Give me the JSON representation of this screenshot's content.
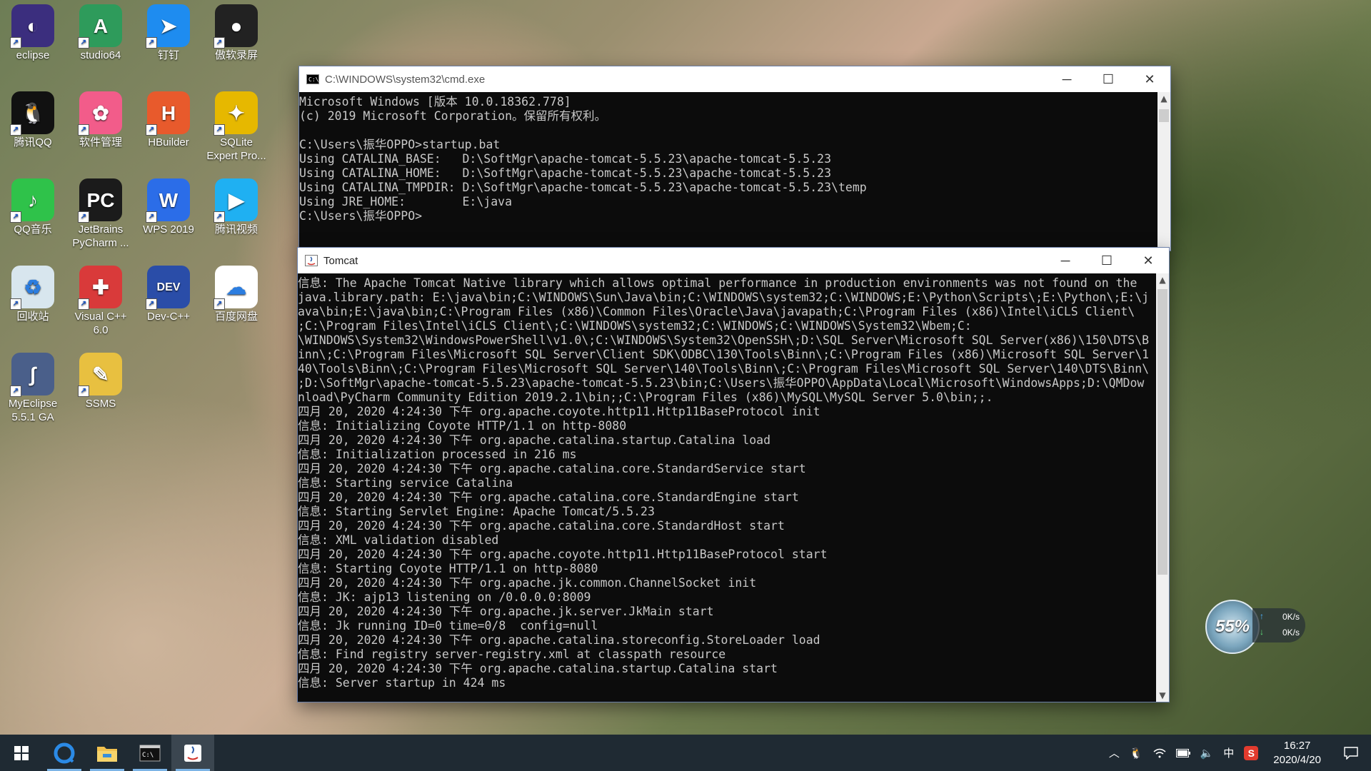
{
  "desktop": {
    "icons": [
      {
        "label": "eclipse",
        "color": "#3b2e7e",
        "symbol": "◐"
      },
      {
        "label": "studio64",
        "color": "#2e9b5b",
        "symbol": "A"
      },
      {
        "label": "钉钉",
        "color": "#1e8cf0",
        "symbol": "➤"
      },
      {
        "label": "傲软录屏",
        "color": "#222222",
        "symbol": "●"
      },
      {
        "label": "腾讯QQ",
        "color": "#111111",
        "symbol": "🐧"
      },
      {
        "label": "软件管理",
        "color": "#f25c8a",
        "symbol": "✿"
      },
      {
        "label": "HBuilder",
        "color": "#e85a2c",
        "symbol": "H"
      },
      {
        "label": "SQLite Expert Pro...",
        "color": "#e6b800",
        "symbol": "✦"
      },
      {
        "label": "QQ音乐",
        "color": "#2fc24a",
        "symbol": "♪"
      },
      {
        "label": "JetBrains PyCharm ...",
        "color": "#1b1b1b",
        "symbol": "PC"
      },
      {
        "label": "WPS 2019",
        "color": "#2b6de8",
        "symbol": "W"
      },
      {
        "label": "腾讯视频",
        "color": "#1fb0f2",
        "symbol": "▶"
      },
      {
        "label": "回收站",
        "color": "#d8e6ee",
        "symbol": "♻"
      },
      {
        "label": "Visual C++ 6.0",
        "color": "#d93a3a",
        "symbol": "✚"
      },
      {
        "label": "Dev-C++",
        "color": "#2a4da8",
        "symbol": "DEV"
      },
      {
        "label": "百度网盘",
        "color": "#ffffff",
        "symbol": "☁"
      },
      {
        "label": "MyEclipse 5.5.1 GA",
        "color": "#4a5f8a",
        "symbol": "∫"
      },
      {
        "label": "SSMS",
        "color": "#e8c040",
        "symbol": "✎"
      }
    ]
  },
  "cmd_window": {
    "title": "C:\\WINDOWS\\system32\\cmd.exe",
    "lines": [
      "Microsoft Windows [版本 10.0.18362.778]",
      "(c) 2019 Microsoft Corporation。保留所有权利。",
      "",
      "C:\\Users\\振华OPPO>startup.bat",
      "Using CATALINA_BASE:   D:\\SoftMgr\\apache-tomcat-5.5.23\\apache-tomcat-5.5.23",
      "Using CATALINA_HOME:   D:\\SoftMgr\\apache-tomcat-5.5.23\\apache-tomcat-5.5.23",
      "Using CATALINA_TMPDIR: D:\\SoftMgr\\apache-tomcat-5.5.23\\apache-tomcat-5.5.23\\temp",
      "Using JRE_HOME:        E:\\java",
      "C:\\Users\\振华OPPO>"
    ]
  },
  "tomcat_window": {
    "title": "Tomcat",
    "lines": [
      "信息: The Apache Tomcat Native library which allows optimal performance in production environments was not found on the",
      "java.library.path: E:\\java\\bin;C:\\WINDOWS\\Sun\\Java\\bin;C:\\WINDOWS\\system32;C:\\WINDOWS;E:\\Python\\Scripts\\;E:\\Python\\;E:\\j",
      "ava\\bin;E:\\java\\bin;C:\\Program Files (x86)\\Common Files\\Oracle\\Java\\javapath;C:\\Program Files (x86)\\Intel\\iCLS Client\\",
      ";C:\\Program Files\\Intel\\iCLS Client\\;C:\\WINDOWS\\system32;C:\\WINDOWS;C:\\WINDOWS\\System32\\Wbem;C:",
      "\\WINDOWS\\System32\\WindowsPowerShell\\v1.0\\;C:\\WINDOWS\\System32\\OpenSSH\\;D:\\SQL Server\\Microsoft SQL Server(x86)\\150\\DTS\\B",
      "inn\\;C:\\Program Files\\Microsoft SQL Server\\Client SDK\\ODBC\\130\\Tools\\Binn\\;C:\\Program Files (x86)\\Microsoft SQL Server\\1",
      "40\\Tools\\Binn\\;C:\\Program Files\\Microsoft SQL Server\\140\\Tools\\Binn\\;C:\\Program Files\\Microsoft SQL Server\\140\\DTS\\Binn\\",
      ";D:\\SoftMgr\\apache-tomcat-5.5.23\\apache-tomcat-5.5.23\\bin;C:\\Users\\振华OPPO\\AppData\\Local\\Microsoft\\WindowsApps;D:\\QMDow",
      "nload\\PyCharm Community Edition 2019.2.1\\bin;;C:\\Program Files (x86)\\MySQL\\MySQL Server 5.0\\bin;;.",
      "四月 20, 2020 4:24:30 下午 org.apache.coyote.http11.Http11BaseProtocol init",
      "信息: Initializing Coyote HTTP/1.1 on http-8080",
      "四月 20, 2020 4:24:30 下午 org.apache.catalina.startup.Catalina load",
      "信息: Initialization processed in 216 ms",
      "四月 20, 2020 4:24:30 下午 org.apache.catalina.core.StandardService start",
      "信息: Starting service Catalina",
      "四月 20, 2020 4:24:30 下午 org.apache.catalina.core.StandardEngine start",
      "信息: Starting Servlet Engine: Apache Tomcat/5.5.23",
      "四月 20, 2020 4:24:30 下午 org.apache.catalina.core.StandardHost start",
      "信息: XML validation disabled",
      "四月 20, 2020 4:24:30 下午 org.apache.coyote.http11.Http11BaseProtocol start",
      "信息: Starting Coyote HTTP/1.1 on http-8080",
      "四月 20, 2020 4:24:30 下午 org.apache.jk.common.ChannelSocket init",
      "信息: JK: ajp13 listening on /0.0.0.0:8009",
      "四月 20, 2020 4:24:30 下午 org.apache.jk.server.JkMain start",
      "信息: Jk running ID=0 time=0/8  config=null",
      "四月 20, 2020 4:24:30 下午 org.apache.catalina.storeconfig.StoreLoader load",
      "信息: Find registry server-registry.xml at classpath resource",
      "四月 20, 2020 4:24:30 下午 org.apache.catalina.startup.Catalina start",
      "信息: Server startup in 424 ms"
    ]
  },
  "netmon": {
    "percent": "55%",
    "up": "0K/s",
    "down": "0K/s"
  },
  "taskbar": {
    "tray_ime": "中",
    "time": "16:27",
    "date": "2020/4/20"
  }
}
